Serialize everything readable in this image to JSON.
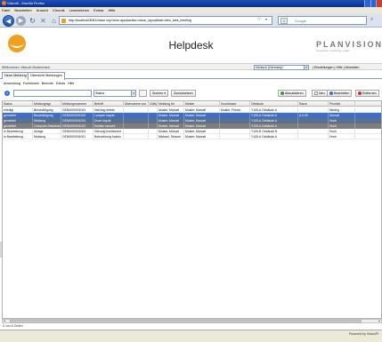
{
  "window": {
    "title": "Visionfi - Mozilla Firefox",
    "menu": [
      "Datei",
      "Bearbeiten",
      "Ansicht",
      "Chronik",
      "Lesezeichen",
      "Extras",
      "Hilfe"
    ],
    "url": "http://localhost:8081/vision.vsp?cmd=ajax&action=vision_layout&tab=view_tabs_meeting",
    "search_placeholder": "Google",
    "search_engine_label": "G"
  },
  "app": {
    "title": "Helpdesk",
    "brand": "PLANVISION",
    "brand_sub": "integrated • solutions • value"
  },
  "infobar": {
    "welcome": "Willkommen: Manuel Mustermann",
    "language": "Deutsch (Germany)",
    "links": "| Einstellungen | Hilfe | Abmelden"
  },
  "tabs": [
    "Neue Meldung",
    "Übersicht Meldungen"
  ],
  "menurow": [
    "Anwendung",
    "Funktionen",
    "Berichte",
    "Extras",
    "Hilfe"
  ],
  "toolbar": {
    "info_glyph": "i",
    "status_select": "Status",
    "search_btn": "Suchen",
    "reset_btn": "Zurücksetzen",
    "refresh_btn": "Aktualisieren",
    "new_btn": "Neu",
    "edit_btn": "Bearbeiten",
    "delete_btn": "Entfernen"
  },
  "grid": {
    "columns": [
      "Status",
      "Meldungstyp",
      "Meldungsnummer",
      "Betreff",
      "Übernahme von",
      "Gültig bis",
      "Meldung für",
      "Melder",
      "Koordinator",
      "Gebäude",
      "Raum",
      "Priorität"
    ],
    "rows": [
      {
        "style": "plain",
        "cells": [
          "erledigt",
          "Beschädigung",
          "GEN0000001004",
          "Heizung defekt",
          "",
          "",
          "Muster, Manuel",
          "Muster, Manuel",
          "Muster, Frieda",
          "Y105-A Gebäude A",
          "",
          "Niedrig"
        ]
      },
      {
        "style": "sel1",
        "cells": [
          "gemeldet",
          "Beschädigung",
          "GEN0000001005",
          "Lampen kaputt",
          "",
          "",
          "Muster, Manuel",
          "Muster, Manuel",
          "",
          "Y105-A Gebäude A",
          "A.0.09",
          "Normal"
        ]
      },
      {
        "style": "sel2",
        "cells": [
          "gemeldet",
          "Meldung",
          "GEN0000001024",
          "Drum kaputt",
          "",
          "",
          "Muster, Manuel",
          "Muster, Manuel",
          "",
          "Y105-A Gebäude A",
          "",
          "Hoch"
        ]
      },
      {
        "style": "sel3",
        "cells": [
          "gemeldet",
          "Computer-Hardware",
          "GEN0000001022",
          "Monitor rauscht",
          "",
          "",
          "Muster, Manuel",
          "Muster, Manuel",
          "",
          "Y105-A Gebäude A",
          "",
          "Hoch"
        ]
      },
      {
        "style": "plain",
        "cells": [
          "in Bearbeitung",
          "Anlage",
          "GEN0000001003",
          "Heizung funktioniert",
          "",
          "",
          "Muster, Manuel",
          "Muster, Manuel",
          "",
          "Y105-B Gebäude B",
          "",
          "Hoch"
        ]
      },
      {
        "style": "plain",
        "cells": [
          "in Bearbeitung",
          "Meldung",
          "GEN0000001001",
          "Beleuchtung funktio",
          "",
          "",
          "Michael, Simone",
          "Muster, Manuel",
          "",
          "Y105-A Gebäude A",
          "",
          "Hoch"
        ]
      }
    ],
    "row_count": "0 von 6 Zeilen"
  },
  "status": {
    "powered": "Powered by VisionPI"
  },
  "colors": {
    "accent": "#3d6fc6",
    "logo": "#f0a020"
  }
}
